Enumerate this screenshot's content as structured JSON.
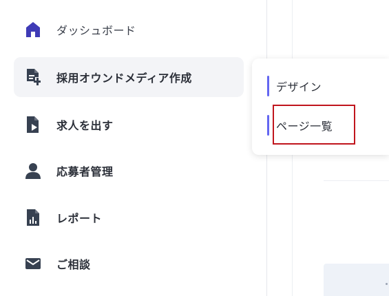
{
  "sidebar": {
    "items": [
      {
        "label": "ダッシュボード",
        "icon": "home-icon"
      },
      {
        "label": "採用オウンドメディア作成",
        "icon": "document-add-icon",
        "active": true
      },
      {
        "label": "求人を出す",
        "icon": "document-send-icon"
      },
      {
        "label": "応募者管理",
        "icon": "user-icon"
      },
      {
        "label": "レポート",
        "icon": "report-chart-icon"
      },
      {
        "label": "ご相談",
        "icon": "envelope-icon"
      }
    ]
  },
  "submenu": {
    "items": [
      {
        "label": "デザイン"
      },
      {
        "label": "ページ一覧",
        "highlighted": true
      }
    ]
  },
  "colors": {
    "accent": "#6366f1",
    "icon_home": "#3f3bb6",
    "icon_dark": "#374151",
    "highlight_border": "#c0141c",
    "active_bg": "#f3f4f7"
  }
}
